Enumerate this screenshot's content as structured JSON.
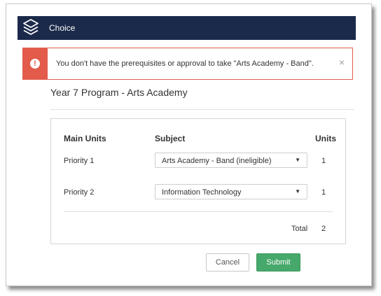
{
  "header": {
    "title": "Choice",
    "logo_icon": "layers-icon",
    "background": "#1b2a4a"
  },
  "alert": {
    "icon": "exclamation-circle-icon",
    "message": "You don't have the prerequisites or approval to take \"Arts Academy - Band\".",
    "close_label": "×",
    "color": "#e25b4b"
  },
  "page": {
    "title": "Year 7 Program - Arts Academy"
  },
  "table": {
    "headers": {
      "main_units": "Main Units",
      "subject": "Subject",
      "units": "Units"
    },
    "rows": [
      {
        "label": "Priority 1",
        "subject": "Arts Academy - Band (ineligible)",
        "units": "1"
      },
      {
        "label": "Priority 2",
        "subject": "Information Technology",
        "units": "1"
      }
    ],
    "total_label": "Total",
    "total_value": "2"
  },
  "buttons": {
    "cancel": "Cancel",
    "submit": "Submit",
    "submit_color": "#46a86a"
  }
}
